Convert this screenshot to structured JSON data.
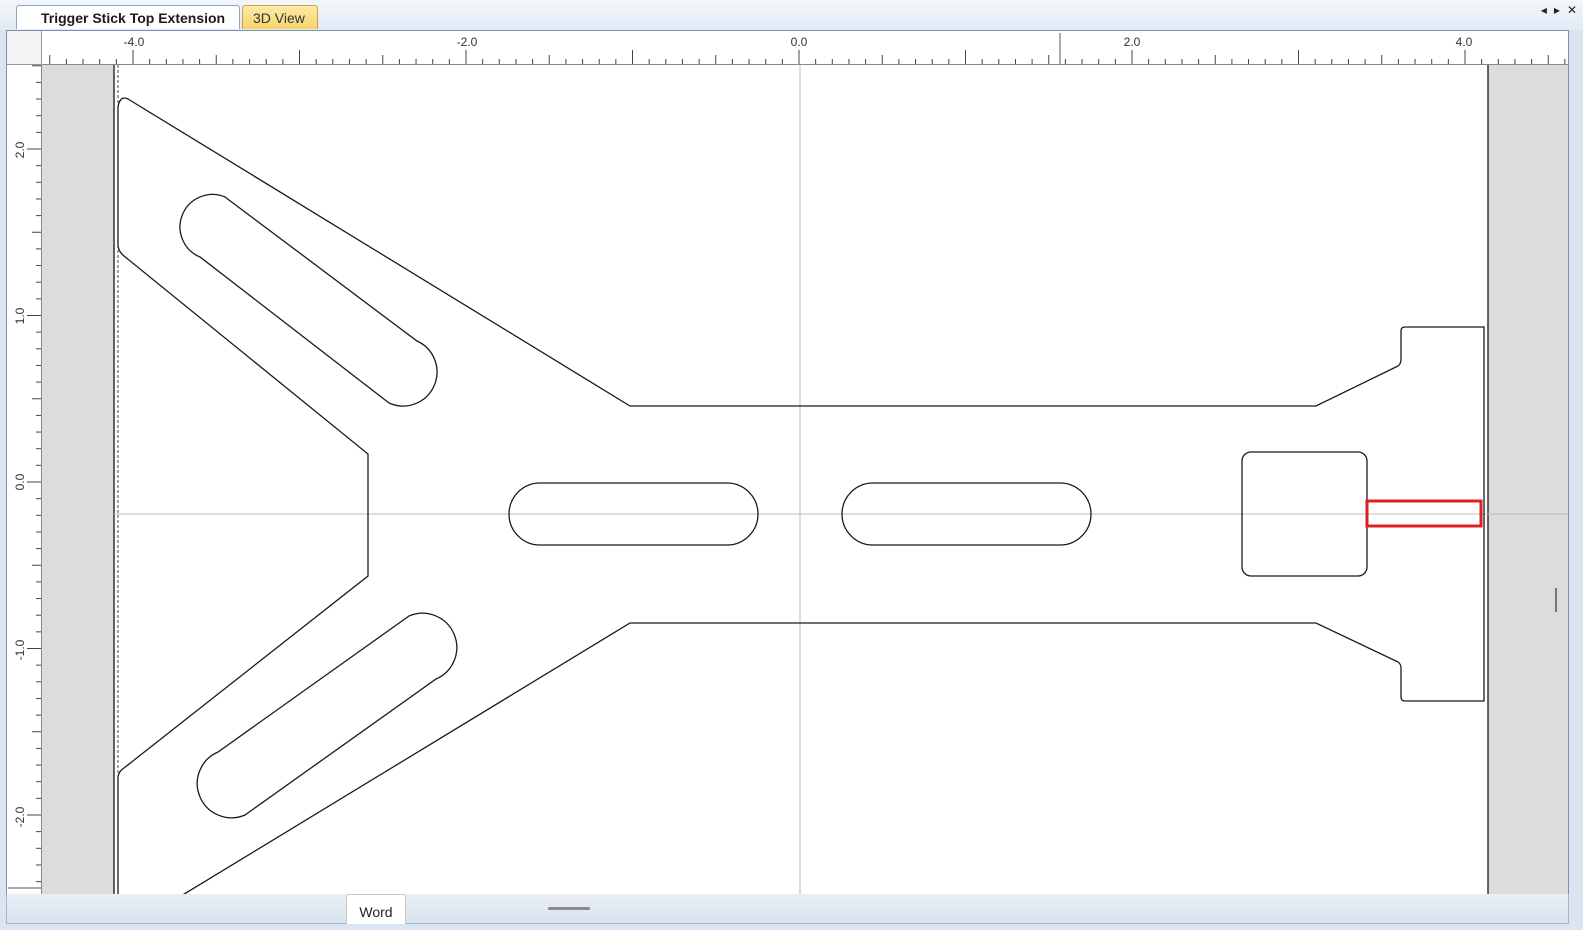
{
  "window": {
    "tabs": [
      {
        "label": "Trigger Stick Top Extension",
        "active": true
      },
      {
        "label": "3D View",
        "active": false
      }
    ],
    "controls": {
      "prev": "◂",
      "next": "▸",
      "close": "✕"
    }
  },
  "ruler": {
    "horizontal_labels": [
      "-4.0",
      "-2.0",
      "0.0",
      "2.0",
      "4.0"
    ],
    "vertical_labels": [
      "2.0",
      "1.0",
      "0.0",
      "-1.0",
      "-2.0"
    ],
    "units_per_major": 1.0
  },
  "drawing": {
    "part_name": "Trigger Stick Top Extension",
    "line_color": "#1a1a1a",
    "highlight_color": "#e02020",
    "axis_color": "#bbbbbb",
    "margin_color": "#dcdcdc"
  },
  "bottom": {
    "word_tab": "Word"
  }
}
